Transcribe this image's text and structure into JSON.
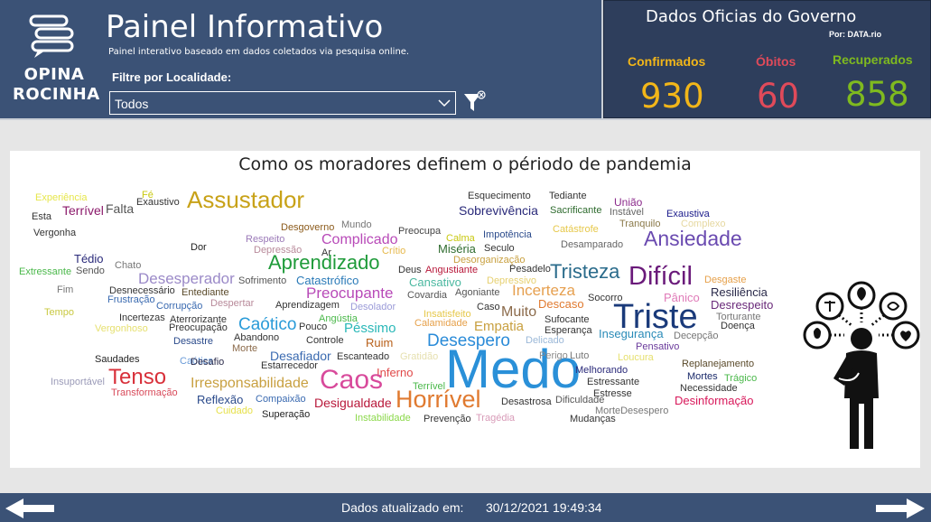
{
  "header": {
    "logo_line1": "OPINA",
    "logo_line2": "ROCINHA",
    "title": "Painel Informativo",
    "subtitle": "Painel interativo baseado em dados coletados via pesquisa online.",
    "filter_label": "Filtre por Localidade:",
    "filter_value": "Todos"
  },
  "gov": {
    "title": "Dados Oficias do Governo",
    "by": "Por: DATA.rio",
    "stats": [
      {
        "label": "Confirmados",
        "value": "930",
        "color": "#f2b619"
      },
      {
        "label": "Óbitos",
        "value": "60",
        "color": "#e04a5a"
      },
      {
        "label": "Recuperados",
        "value": "858",
        "color": "#7fba1f"
      }
    ]
  },
  "cloud": {
    "title": "Como os moradores definem o périodo de pandemia",
    "words": [
      {
        "text": "Experiência",
        "size": 11,
        "color": "#e6e64a"
      },
      {
        "text": "Fé",
        "size": 11,
        "color": "#c9c910"
      },
      {
        "text": "Terrível",
        "size": 14,
        "color": "#8b1a6b"
      },
      {
        "text": "Falta",
        "size": 14,
        "color": "#555555"
      },
      {
        "text": "Exaustivo",
        "size": 11,
        "color": "#333333"
      },
      {
        "text": "Esta",
        "size": 11,
        "color": "#333333"
      },
      {
        "text": "Assustador",
        "size": 26,
        "color": "#c8a218"
      },
      {
        "text": "Vergonha",
        "size": 11,
        "color": "#333333"
      },
      {
        "text": "Esquecimento",
        "size": 11,
        "color": "#333333"
      },
      {
        "text": "Sobrevivência",
        "size": 14,
        "color": "#2a2a7a"
      },
      {
        "text": "Tediante",
        "size": 11,
        "color": "#333333"
      },
      {
        "text": "Sacrificante",
        "size": 11,
        "color": "#2e6b2e"
      },
      {
        "text": "União",
        "size": 12,
        "color": "#8b2a8b"
      },
      {
        "text": "Instável",
        "size": 11,
        "color": "#666666"
      },
      {
        "text": "Exaustiva",
        "size": 11,
        "color": "#1a1a8b"
      },
      {
        "text": "Desgoverno",
        "size": 11,
        "color": "#8b5a1a"
      },
      {
        "text": "Mundo",
        "size": 11,
        "color": "#777777"
      },
      {
        "text": "Preocupa",
        "size": 11,
        "color": "#444444"
      },
      {
        "text": "Catástrofe",
        "size": 11,
        "color": "#e6c84a"
      },
      {
        "text": "Tranquilo",
        "size": 11,
        "color": "#8b7a4a"
      },
      {
        "text": "Complexo",
        "size": 11,
        "color": "#e6d8a0"
      },
      {
        "text": "Calma",
        "size": 11,
        "color": "#c8c810"
      },
      {
        "text": "Impotência",
        "size": 11,
        "color": "#2a4a8b"
      },
      {
        "text": "Respeito",
        "size": 11,
        "color": "#9b7ab8"
      },
      {
        "text": "Complicado",
        "size": 16,
        "color": "#b84ab8"
      },
      {
        "text": "Miséria",
        "size": 13,
        "color": "#2e6b2e"
      },
      {
        "text": "Seculo",
        "size": 11,
        "color": "#333333"
      },
      {
        "text": "Desamparado",
        "size": 11,
        "color": "#666666"
      },
      {
        "text": "Ansiedade",
        "size": 23,
        "color": "#6a4ab0"
      },
      {
        "text": "Tédio",
        "size": 13,
        "color": "#2a2a7a"
      },
      {
        "text": "Dor",
        "size": 11,
        "color": "#222222"
      },
      {
        "text": "Depressão",
        "size": 11,
        "color": "#b88a9a"
      },
      {
        "text": "Ar",
        "size": 11,
        "color": "#333333"
      },
      {
        "text": "Crítio",
        "size": 11,
        "color": "#e6b84a"
      },
      {
        "text": "Desorganização",
        "size": 11,
        "color": "#c8a040"
      },
      {
        "text": "Chato",
        "size": 11,
        "color": "#777777"
      },
      {
        "text": "Aprendizado",
        "size": 22,
        "color": "#1f9b3a"
      },
      {
        "text": "Deus",
        "size": 11,
        "color": "#333333"
      },
      {
        "text": "Angustiante",
        "size": 11,
        "color": "#b8183a"
      },
      {
        "text": "Pesadelo",
        "size": 11,
        "color": "#333333"
      },
      {
        "text": "Tristeza",
        "size": 22,
        "color": "#2a6b8b"
      },
      {
        "text": "Difícil",
        "size": 29,
        "color": "#6a1a7a"
      },
      {
        "text": "Desgaste",
        "size": 11,
        "color": "#e6a04a"
      },
      {
        "text": "Extressante",
        "size": 11,
        "color": "#4ab84a"
      },
      {
        "text": "Sendo",
        "size": 11,
        "color": "#555555"
      },
      {
        "text": "Desesperador",
        "size": 17,
        "color": "#9b8ac8"
      },
      {
        "text": "Sofrimento",
        "size": 11,
        "color": "#555555"
      },
      {
        "text": "Catastrófico",
        "size": 13,
        "color": "#2a7ab8"
      },
      {
        "text": "Cansativo",
        "size": 13,
        "color": "#4ab8a0"
      },
      {
        "text": "Depressivo",
        "size": 11,
        "color": "#e6d070"
      },
      {
        "text": "Incerteza",
        "size": 17,
        "color": "#e6a050"
      },
      {
        "text": "Pânico",
        "size": 13,
        "color": "#e07ab8"
      },
      {
        "text": "Resiliência",
        "size": 13,
        "color": "#2a2a4a"
      },
      {
        "text": "Fim",
        "size": 11,
        "color": "#777777"
      },
      {
        "text": "Desnecessário",
        "size": 11,
        "color": "#333333"
      },
      {
        "text": "Entediante",
        "size": 11,
        "color": "#5a4a2a"
      },
      {
        "text": "Frustração",
        "size": 11,
        "color": "#3a6ab0"
      },
      {
        "text": "Preocupante",
        "size": 17,
        "color": "#b84ab8"
      },
      {
        "text": "Covardia",
        "size": 11,
        "color": "#555555"
      },
      {
        "text": "Agoniante",
        "size": 11,
        "color": "#555555"
      },
      {
        "text": "Socorro",
        "size": 11,
        "color": "#333333"
      },
      {
        "text": "Desrespeito",
        "size": 13,
        "color": "#6a2a7a"
      },
      {
        "text": "Corrupção",
        "size": 11,
        "color": "#3a6ab0"
      },
      {
        "text": "Despertar",
        "size": 11,
        "color": "#b88a9a"
      },
      {
        "text": "Aprendizagem",
        "size": 11,
        "color": "#333333"
      },
      {
        "text": "Desolador",
        "size": 11,
        "color": "#9b9bd8"
      },
      {
        "text": "Caso",
        "size": 11,
        "color": "#333333"
      },
      {
        "text": "Descaso",
        "size": 13,
        "color": "#e07a30"
      },
      {
        "text": "Triste",
        "size": 38,
        "color": "#1a3a7a"
      },
      {
        "text": "Torturante",
        "size": 11,
        "color": "#777777"
      },
      {
        "text": "Tempo",
        "size": 11,
        "color": "#c8c840"
      },
      {
        "text": "Incertezas",
        "size": 11,
        "color": "#333333"
      },
      {
        "text": "Aterrorizante",
        "size": 11,
        "color": "#333333"
      },
      {
        "text": "Caótico",
        "size": 19,
        "color": "#2a9bd8"
      },
      {
        "text": "Angústia",
        "size": 11,
        "color": "#4ab84a"
      },
      {
        "text": "Insatisfeito",
        "size": 11,
        "color": "#e6c84a"
      },
      {
        "text": "Muito",
        "size": 16,
        "color": "#8b6a4a"
      },
      {
        "text": "Sufocante",
        "size": 11,
        "color": "#333333"
      },
      {
        "text": "Doença",
        "size": 11,
        "color": "#333333"
      },
      {
        "text": "Vergonhoso",
        "size": 11,
        "color": "#e6e070"
      },
      {
        "text": "Preocupação",
        "size": 11,
        "color": "#333333"
      },
      {
        "text": "Pouco",
        "size": 11,
        "color": "#333333"
      },
      {
        "text": "Péssimo",
        "size": 15,
        "color": "#2ab8b8"
      },
      {
        "text": "Calamidade",
        "size": 11,
        "color": "#e6a04a"
      },
      {
        "text": "Empatia",
        "size": 15,
        "color": "#c8a040"
      },
      {
        "text": "Esperança",
        "size": 11,
        "color": "#333333"
      },
      {
        "text": "Insegurança",
        "size": 13,
        "color": "#2a8bb8"
      },
      {
        "text": "Decepção",
        "size": 11,
        "color": "#777777"
      },
      {
        "text": "Desastre",
        "size": 11,
        "color": "#2a4a8b"
      },
      {
        "text": "Abandono",
        "size": 11,
        "color": "#333333"
      },
      {
        "text": "Controle",
        "size": 11,
        "color": "#333333"
      },
      {
        "text": "Ruim",
        "size": 13,
        "color": "#b8601a"
      },
      {
        "text": "Desespero",
        "size": 19,
        "color": "#2a8bd8"
      },
      {
        "text": "Delicado",
        "size": 11,
        "color": "#9bb8d8"
      },
      {
        "text": "Pensativo",
        "size": 11,
        "color": "#6a3a9b"
      },
      {
        "text": "Morte",
        "size": 11,
        "color": "#8b6a4a"
      },
      {
        "text": "Saudades",
        "size": 11,
        "color": "#222222"
      },
      {
        "text": "Caótica",
        "size": 11,
        "color": "#6a9bd8"
      },
      {
        "text": "Desafio",
        "size": 11,
        "color": "#2a2a4a"
      },
      {
        "text": "Desafiador",
        "size": 14,
        "color": "#3a6ab0"
      },
      {
        "text": "Escanteado",
        "size": 11,
        "color": "#333333"
      },
      {
        "text": "Gratidão",
        "size": 11,
        "color": "#e6e0b0"
      },
      {
        "text": "Medo",
        "size": 60,
        "color": "#2a90d8"
      },
      {
        "text": "Perigo",
        "size": 11,
        "color": "#8b8b8b"
      },
      {
        "text": "Luto",
        "size": 11,
        "color": "#777777"
      },
      {
        "text": "Loucura",
        "size": 11,
        "color": "#e6e070"
      },
      {
        "text": "Replanejamento",
        "size": 11,
        "color": "#5a4a2a"
      },
      {
        "text": "Estarrecedor",
        "size": 11,
        "color": "#333333"
      },
      {
        "text": "Melhorando",
        "size": 11,
        "color": "#2a2a7a"
      },
      {
        "text": "Insuportável",
        "size": 11,
        "color": "#9b9bb8"
      },
      {
        "text": "Tenso",
        "size": 24,
        "color": "#d8303a"
      },
      {
        "text": "Inferno",
        "size": 13,
        "color": "#e04a4a"
      },
      {
        "text": "Estressante",
        "size": 11,
        "color": "#333333"
      },
      {
        "text": "Mortes",
        "size": 11,
        "color": "#1a2a6a"
      },
      {
        "text": "Trágico",
        "size": 11,
        "color": "#4ab84a"
      },
      {
        "text": "Irresponsabilidade",
        "size": 16,
        "color": "#c8a040"
      },
      {
        "text": "Caos",
        "size": 30,
        "color": "#d84a9b"
      },
      {
        "text": "Terrível",
        "size": 11,
        "color": "#4ab84a"
      },
      {
        "text": "Necessidade",
        "size": 11,
        "color": "#333333"
      },
      {
        "text": "Transformação",
        "size": 11,
        "color": "#d84a5a"
      },
      {
        "text": "Estresse",
        "size": 11,
        "color": "#333333"
      },
      {
        "text": "Reflexão",
        "size": 13,
        "color": "#2a4a8b"
      },
      {
        "text": "Compaixão",
        "size": 11,
        "color": "#3a6ab0"
      },
      {
        "text": "Desigualdade",
        "size": 14,
        "color": "#b8183a"
      },
      {
        "text": "Horrível",
        "size": 27,
        "color": "#e07a30"
      },
      {
        "text": "Desastrosa",
        "size": 11,
        "color": "#333333"
      },
      {
        "text": "Dificuldade",
        "size": 11,
        "color": "#555555"
      },
      {
        "text": "Desinformação",
        "size": 13,
        "color": "#d8185a"
      },
      {
        "text": "Cuidado",
        "size": 11,
        "color": "#e6e04a"
      },
      {
        "text": "Superação",
        "size": 11,
        "color": "#222222"
      },
      {
        "text": "Instabilidade",
        "size": 11,
        "color": "#8bd84a"
      },
      {
        "text": "Prevenção",
        "size": 11,
        "color": "#333333"
      },
      {
        "text": "Tragédia",
        "size": 11,
        "color": "#d89bb8"
      },
      {
        "text": "Mudanças",
        "size": 11,
        "color": "#333333"
      },
      {
        "text": "MorteDesespero",
        "size": 11,
        "color": "#777777"
      }
    ]
  },
  "footer": {
    "label": "Dados atualizado em:",
    "date": "30/12/2021 19:49:34"
  }
}
